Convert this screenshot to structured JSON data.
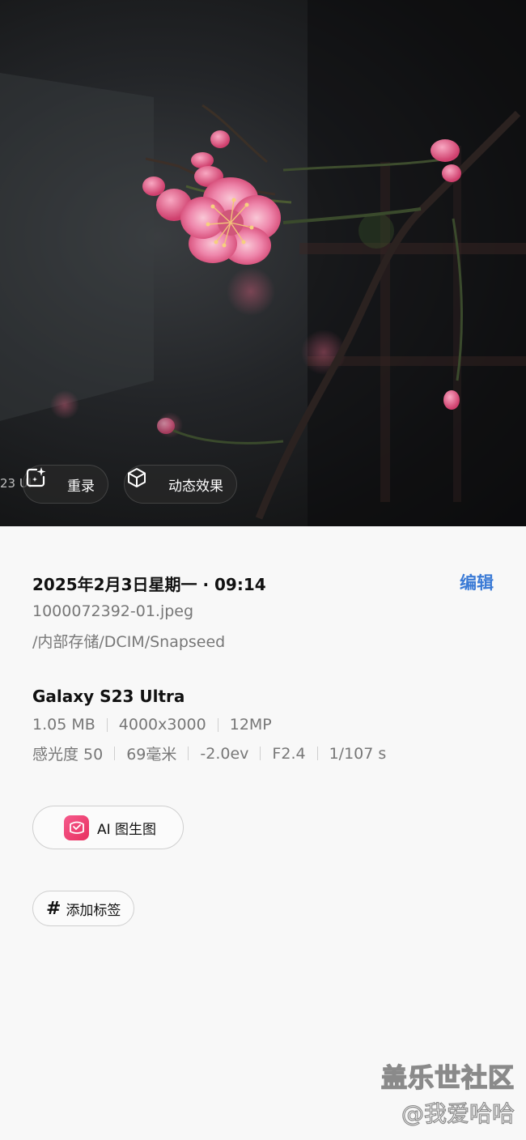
{
  "photo": {
    "overlay_text": "23 Ul",
    "rerecord_label": "重录",
    "motion_label": "动态效果"
  },
  "details": {
    "date": "2025年2月3日星期一 · 09:14",
    "edit_label": "编辑",
    "file_name": "1000072392-01.jpeg",
    "file_path": "/内部存储/DCIM/Snapseed",
    "device": "Galaxy S23 Ultra",
    "size": "1.05 MB",
    "resolution": "4000x3000",
    "megapixels": "12MP",
    "iso": "感光度 50",
    "focal_length": "69毫米",
    "exposure_bias": "-2.0ev",
    "aperture": "F2.4",
    "shutter": "1/107 s"
  },
  "actions": {
    "ai_label": "AI 图生图",
    "tag_label": "添加标签",
    "tag_icon": "#"
  },
  "watermark": {
    "line1": "盖乐世社区",
    "line2": "@我爱哈哈"
  },
  "colors": {
    "accent": "#3b7bd6",
    "blossom": "#e9709a"
  }
}
